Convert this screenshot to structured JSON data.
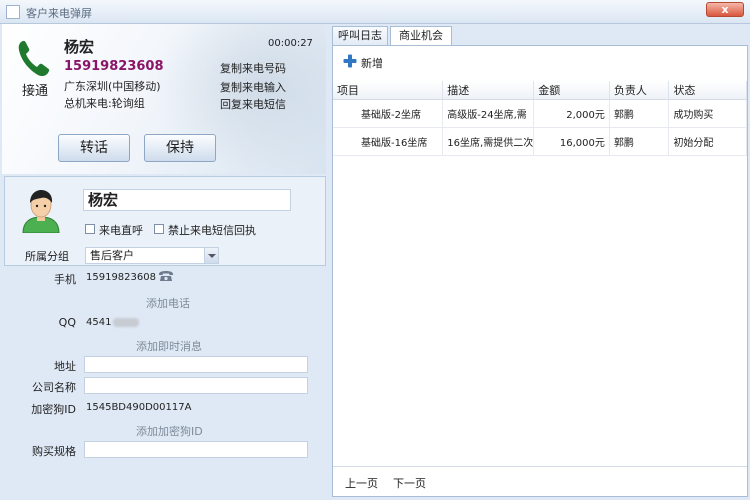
{
  "window": {
    "title": "客户来电弹屏",
    "close_label": "x"
  },
  "call": {
    "answer_label": "接通",
    "caller_name": "杨宏",
    "caller_number": "15919823608",
    "location": "广东深圳(中国移动)",
    "group": "总机来电:轮询组",
    "timer": "00:00:27",
    "links": {
      "copy_number": "复制来电号码",
      "copy_input": "复制来电输入",
      "reply_sms": "回复来电短信"
    },
    "buttons": {
      "transfer": "转话",
      "hold": "保持"
    }
  },
  "contact": {
    "name": "杨宏",
    "checkbox_direct": "来电直呼",
    "checkbox_no_sms": "禁止来电短信回执",
    "group_label": "所属分组",
    "group_value": "售后客户"
  },
  "details": {
    "mobile_label": "手机",
    "mobile_value": "15919823608",
    "add_phone": "添加电话",
    "qq_label": "QQ",
    "qq_value": "4541",
    "add_im": "添加即时消息",
    "address_label": "地址",
    "company_label": "公司名称",
    "dongle_label": "加密狗ID",
    "dongle_value": "1545BD490D00117A",
    "add_dongle": "添加加密狗ID",
    "spec_label": "购买规格"
  },
  "right": {
    "tabs": [
      "呼叫日志",
      "商业机会"
    ],
    "add_label": "新增",
    "columns": [
      "项目",
      "描述",
      "金额",
      "负责人",
      "状态"
    ],
    "rows": [
      {
        "item": "基础版-2坐席",
        "desc": "高级版-24坐席,需",
        "amount": "2,000元",
        "owner": "郭鹏",
        "status": "成功购买"
      },
      {
        "item": "基础版-16坐席",
        "desc": "16坐席,需提供二次",
        "amount": "16,000元",
        "owner": "郭鹏",
        "status": "初始分配"
      }
    ],
    "pager": {
      "prev": "上一页",
      "next": "下一页"
    }
  },
  "colors": {
    "number": "#8a1468",
    "phone_icon": "#1f7a2e"
  },
  "icons": {
    "phone": "phone-icon",
    "avatar": "avatar-icon",
    "add": "plus-icon",
    "tel": "telephone-icon"
  }
}
